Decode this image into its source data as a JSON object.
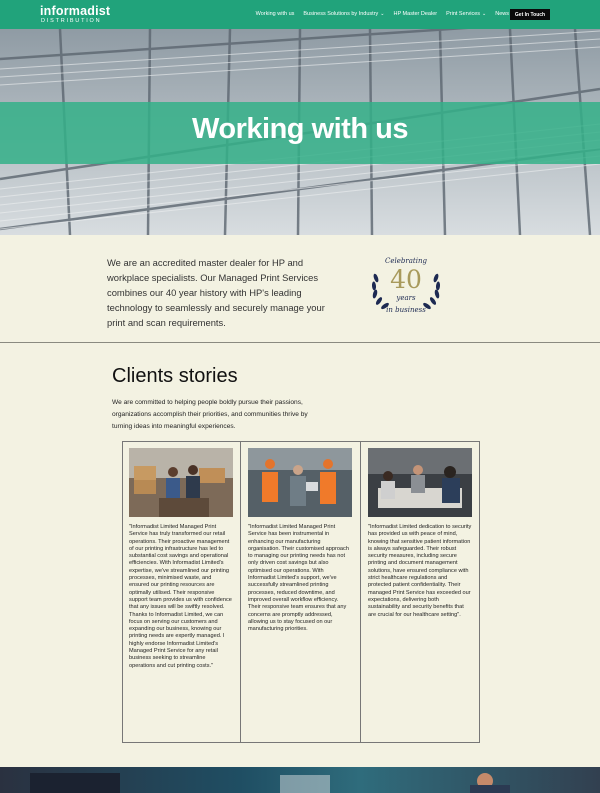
{
  "brand": {
    "name": "informadist",
    "sub": "DISTRIBUTION"
  },
  "nav": {
    "items": [
      {
        "label": "Working with us",
        "caret": false
      },
      {
        "label": "Business Solutions by Industry",
        "caret": true
      },
      {
        "label": "HP Master Dealer",
        "caret": false
      },
      {
        "label": "Print Services",
        "caret": true
      },
      {
        "label": "News",
        "caret": false
      }
    ],
    "cta": "Get In Touch"
  },
  "hero": {
    "title": "Working with us"
  },
  "intro": {
    "text": "We are an accredited master dealer for HP and workplace specialists. Our Managed Print Services combines our 40 year history with HP's leading technology to seamlessly and securely manage your print and scan requirements."
  },
  "badge": {
    "celebrating": "Celebrating",
    "number": "40",
    "years": "years",
    "subtitle": "in business"
  },
  "clients": {
    "title": "Clients stories",
    "description": "We are committed to helping people boldly pursue their passions, organizations accomplish their priorities, and communities thrive by turning ideas into meaningful experiences.",
    "stories": [
      {
        "text": "\"Informadist Limited Managed Print Service has truly transformed our retail operations. Their proactive management of our printing infrastructure has led to substantial cost savings and operational efficiencies. With Informadist Limited's expertise, we've streamlined our printing processes, minimised waste, and ensured our printing resources are optimally utilised. Their responsive support team provides us with confidence that any issues will be swiftly resolved. Thanks to Informadist Limited, we can focus on serving our customers and expanding our business, knowing our printing needs are expertly managed. I highly endorse Informadist Limited's Managed Print Service for any retail business seeking to streamline operations and cut printing costs.\""
      },
      {
        "text": "\"Informadist Limited Managed Print Service has been instrumental in enhancing our manufacturing organisation. Their customised approach to managing our printing needs has not only driven cost savings but also optimised our operations. With Informadist Limited's support, we've successfully streamlined printing processes, reduced downtime, and improved overall workflow efficiency. Their responsive team ensures that any concerns are promptly addressed, allowing us to stay focused on our manufacturing priorities."
      },
      {
        "text": "\"Informadist Limited dedication to security has provided us with peace of mind, knowing that sensitive patient information is always safeguarded. Their robust security measures, including secure printing and document management solutions, have ensured compliance with strict healthcare regulations and protected patient confidentiality. Their managed Print Service has exceeded our expectations, delivering both sustainability and security benefits that are crucial for our healthcare setting\"."
      }
    ]
  },
  "colors": {
    "brand_green": "#21a37b",
    "hero_band": "#34b088",
    "page_bg": "#f3f2e2",
    "cta_bg": "#0a0a0a",
    "badge_navy": "#1d2a52",
    "badge_gold": "#a89a5c"
  }
}
